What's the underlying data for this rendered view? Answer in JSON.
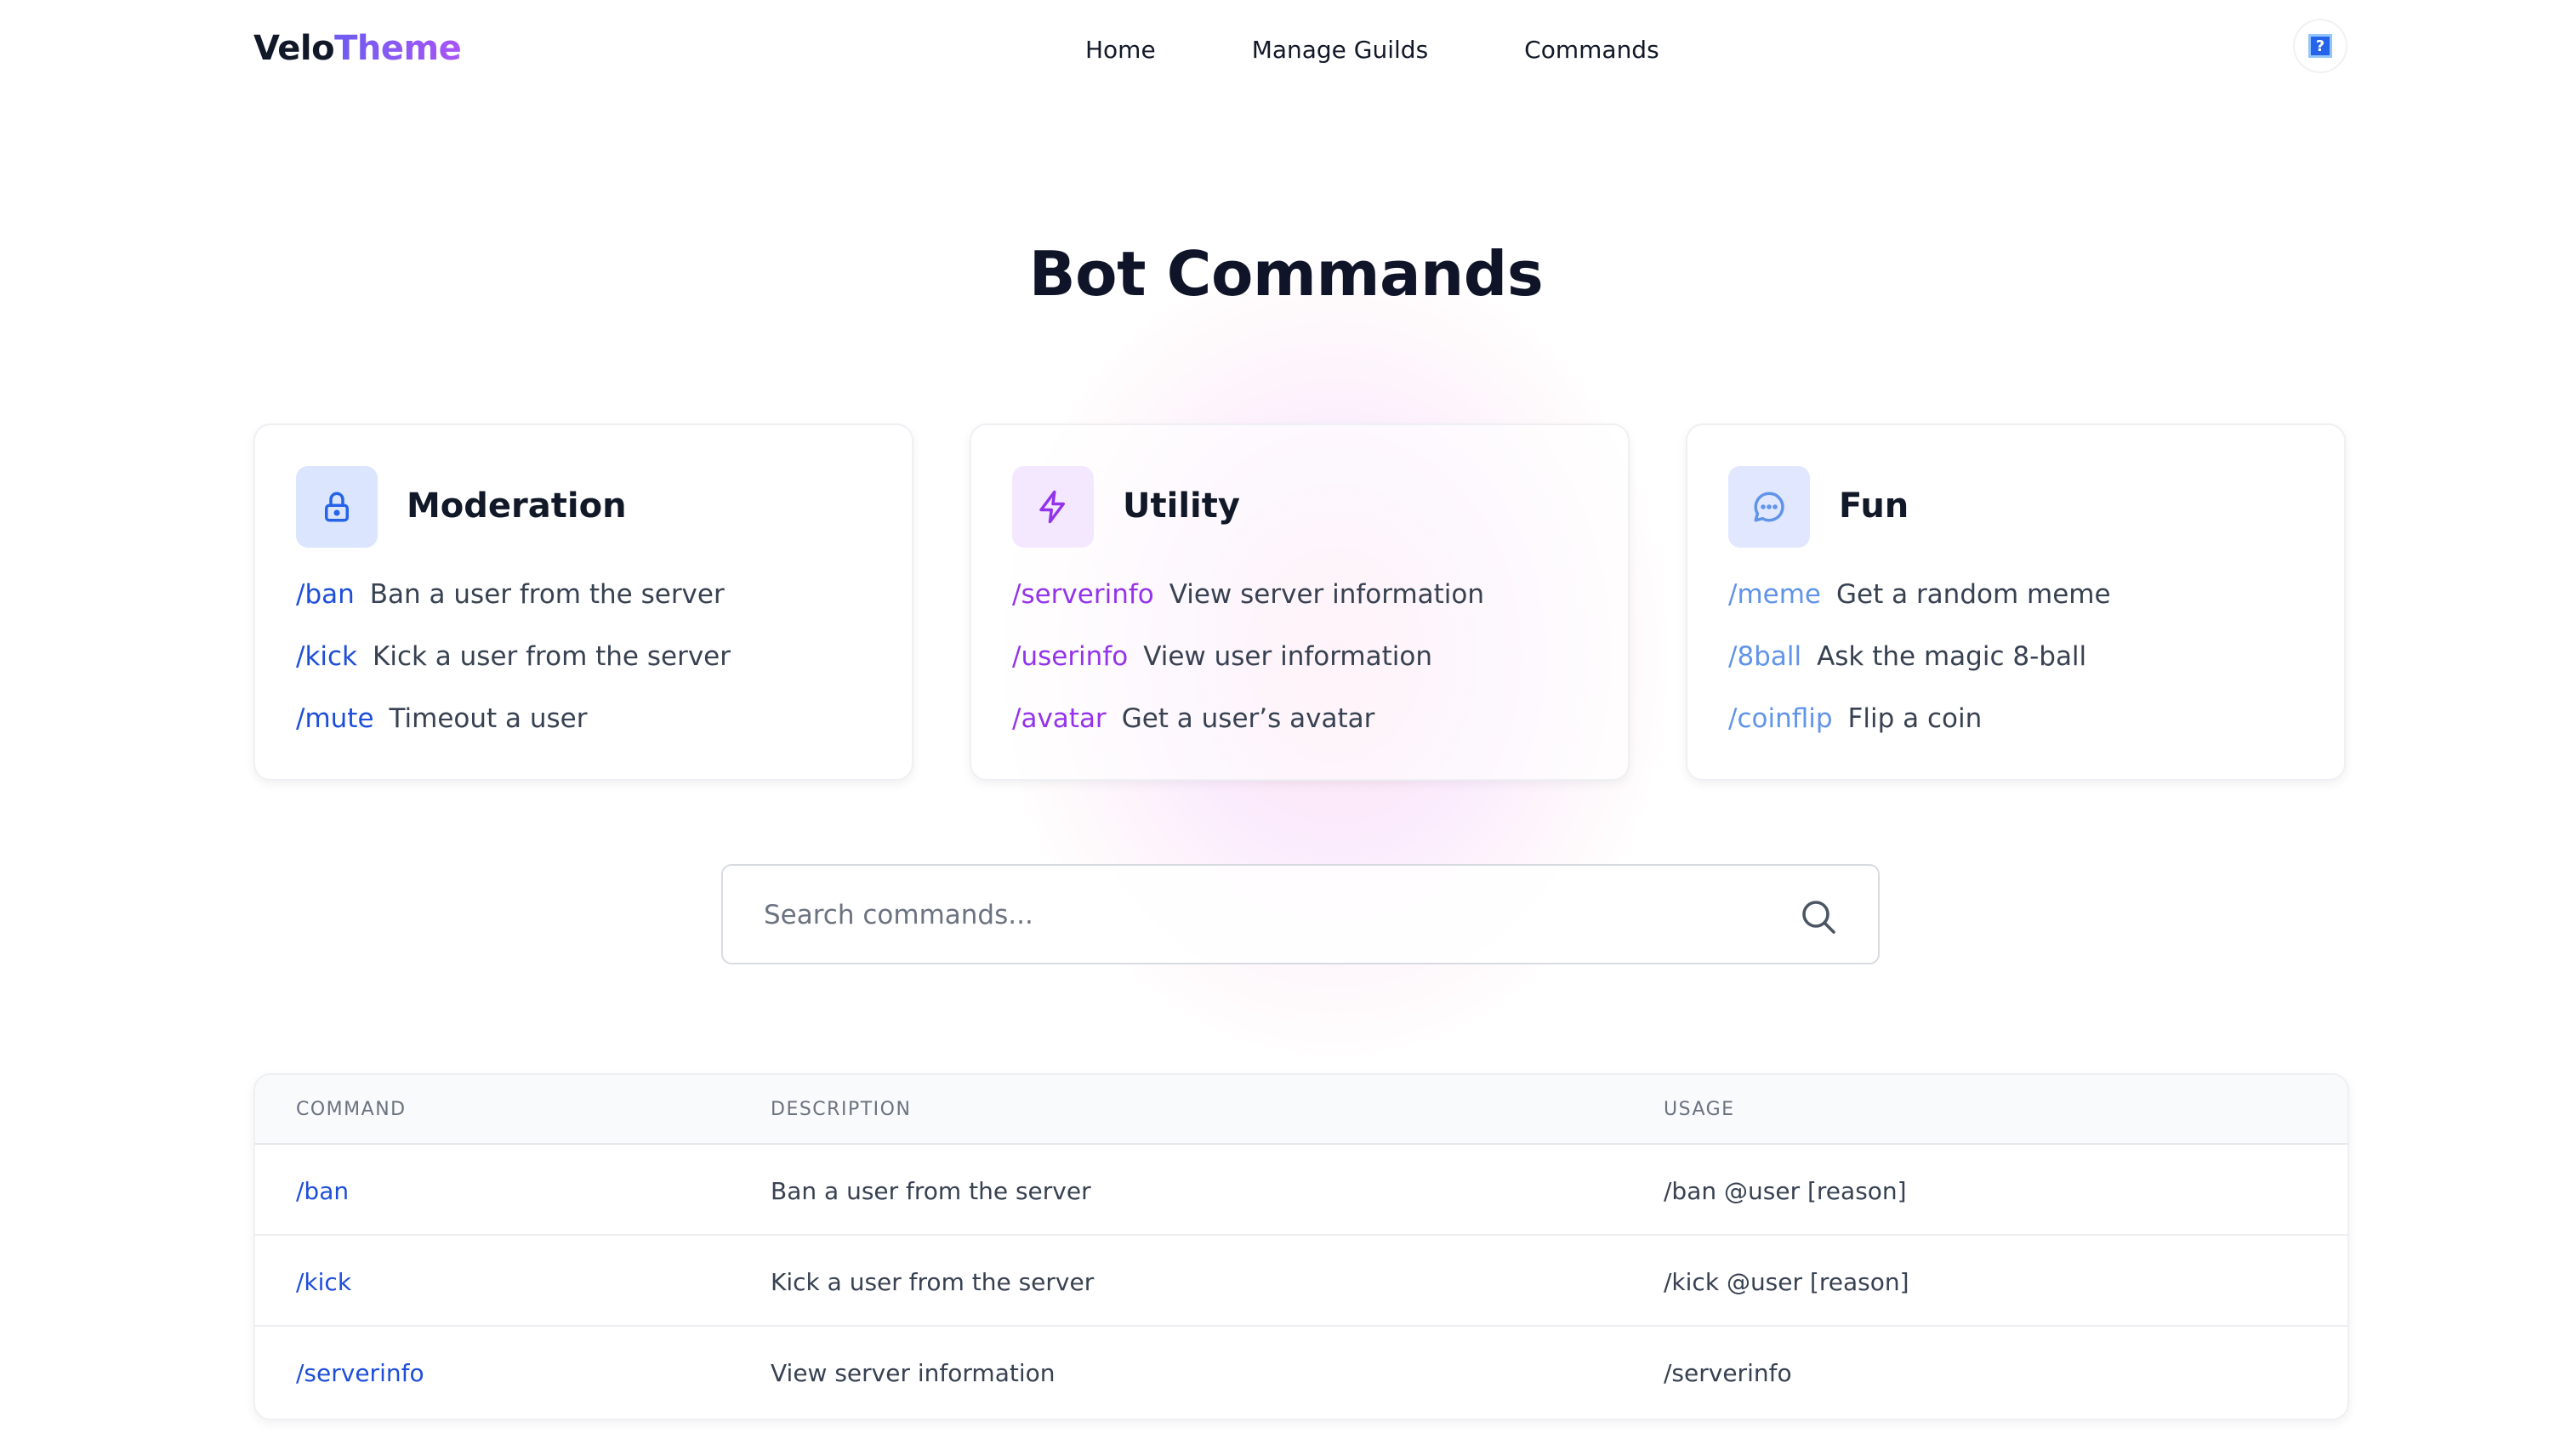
{
  "nav": {
    "brand_part1": "Velo",
    "brand_part2": "Theme",
    "links": [
      "Home",
      "Manage Guilds",
      "Commands"
    ],
    "avatar_icon": "broken-image-icon"
  },
  "page": {
    "title": "Bot Commands"
  },
  "cards": [
    {
      "title": "Moderation",
      "icon": "lock-icon",
      "accent": "#1d4ed8",
      "commands": [
        {
          "name": "/ban",
          "desc": "Ban a user from the server"
        },
        {
          "name": "/kick",
          "desc": "Kick a user from the server"
        },
        {
          "name": "/mute",
          "desc": "Timeout a user"
        }
      ]
    },
    {
      "title": "Utility",
      "icon": "lightning-icon",
      "accent": "#9333ea",
      "commands": [
        {
          "name": "/serverinfo",
          "desc": "View server information"
        },
        {
          "name": "/userinfo",
          "desc": "View user information"
        },
        {
          "name": "/avatar",
          "desc": "Get a user’s avatar"
        }
      ]
    },
    {
      "title": "Fun",
      "icon": "chat-bubble-icon",
      "accent": "#6094e8",
      "commands": [
        {
          "name": "/meme",
          "desc": "Get a random meme"
        },
        {
          "name": "/8ball",
          "desc": "Ask the magic 8-ball"
        },
        {
          "name": "/coinflip",
          "desc": "Flip a coin"
        }
      ]
    }
  ],
  "search": {
    "placeholder": "Search commands...",
    "value": "",
    "icon": "search-icon"
  },
  "table": {
    "headers": [
      "COMMAND",
      "DESCRIPTION",
      "USAGE"
    ],
    "rows": [
      {
        "command": "/ban",
        "description": "Ban a user from the server",
        "usage": "/ban @user [reason]"
      },
      {
        "command": "/kick",
        "description": "Kick a user from the server",
        "usage": "/kick @user [reason]"
      },
      {
        "command": "/serverinfo",
        "description": "View server information",
        "usage": "/serverinfo"
      }
    ]
  }
}
